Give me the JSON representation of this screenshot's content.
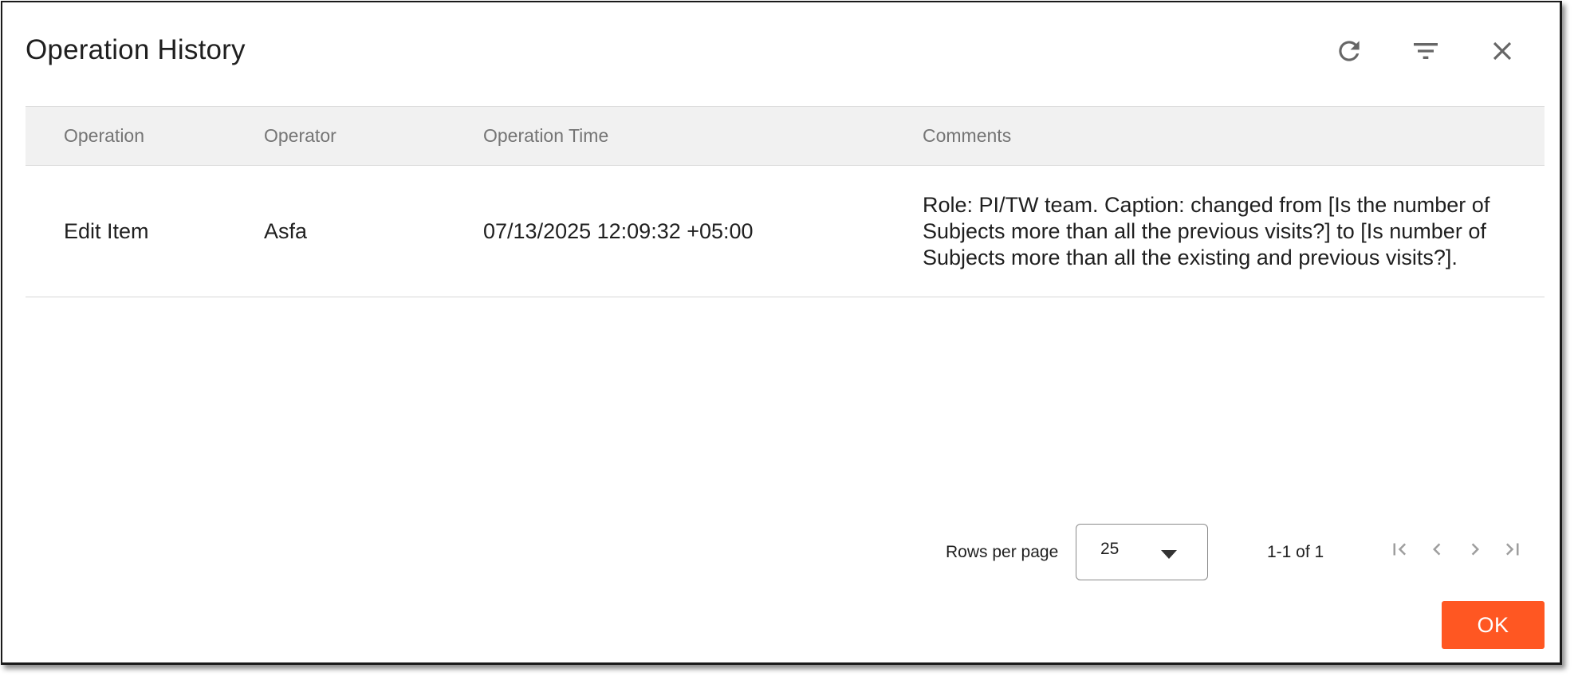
{
  "dialog": {
    "title": "Operation History",
    "icons": {
      "refresh": "refresh-icon",
      "filter": "filter-icon",
      "close": "close-icon"
    }
  },
  "table": {
    "columns": [
      "Operation",
      "Operator",
      "Operation Time",
      "Comments"
    ],
    "rows": [
      {
        "operation": "Edit Item",
        "operator": "Asfa",
        "time": "07/13/2025 12:09:32 +05:00",
        "comments": "Role: PI/TW team. Caption: changed from [Is the number of Subjects more than all the previous visits?] to [Is number of Subjects more than all the existing and previous visits?]."
      }
    ]
  },
  "pagination": {
    "rows_per_page_label": "Rows per page",
    "rows_per_page_value": "25",
    "range_text": "1-1 of 1"
  },
  "footer": {
    "ok_label": "OK"
  },
  "colors": {
    "accent": "#ff5722",
    "header_bg": "#f1f1f1",
    "icon": "#666666"
  }
}
